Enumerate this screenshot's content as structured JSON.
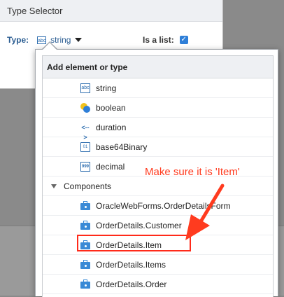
{
  "dialog": {
    "title": "Type Selector",
    "type_label": "Type:",
    "type_icon": "abc",
    "type_value": "string",
    "is_list_label": "Is a list:",
    "is_list_checked": true
  },
  "popup": {
    "title": "Add element or type",
    "items": [
      {
        "label": "string",
        "icon": "abc"
      },
      {
        "label": "boolean",
        "icon": "boolean-icon"
      },
      {
        "label": "duration",
        "icon": "<-->"
      },
      {
        "label": "base64Binary",
        "icon": "binary-icon"
      },
      {
        "label": "decimal",
        "icon": "999"
      }
    ],
    "components_group": "Components",
    "components": [
      {
        "label": "OracleWebForms.OrderDetailsForm"
      },
      {
        "label": "OrderDetails.Customer"
      },
      {
        "label": "OrderDetails.Item"
      },
      {
        "label": "OrderDetails.Items"
      },
      {
        "label": "OrderDetails.Order"
      }
    ]
  },
  "annotation": {
    "text": "Make sure it is 'Item'",
    "color": "#ff3b1f"
  },
  "colors": {
    "accent_blue": "#2f7fd8",
    "link_blue": "#2b5d92",
    "header_bg": "#eef0f3"
  }
}
